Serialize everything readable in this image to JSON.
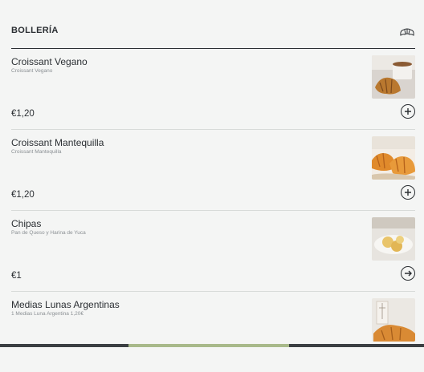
{
  "section": {
    "title": "BOLLERÍA",
    "icon": "croissant-icon"
  },
  "items": [
    {
      "name": "Croissant Vegano",
      "description": "Croissant Vegano",
      "price": "€1,20",
      "action_icon": "plus-circle-icon"
    },
    {
      "name": "Croissant Mantequilla",
      "description": "Croissant Mantequilla",
      "price": "€1,20",
      "action_icon": "plus-circle-icon"
    },
    {
      "name": "Chipas",
      "description": "Pan de Queso y Harina de Yuca",
      "price": "€1",
      "action_icon": "arrow-right-circle-icon"
    },
    {
      "name": "Medias Lunas Argentinas",
      "description": "1 Medias Luna Argentina 1,20€",
      "price": "",
      "action_icon": ""
    }
  ],
  "colors": {
    "background": "#f4f5f4",
    "text": "#2b2f33",
    "muted": "#8a8f93",
    "divider": "#d8dbd9",
    "bottom_bar": "#3b3f42",
    "bottom_progress": "#a8b98a"
  }
}
